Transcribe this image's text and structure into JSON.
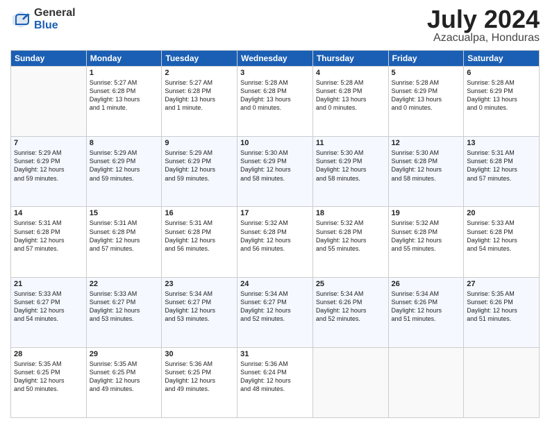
{
  "header": {
    "logo_general": "General",
    "logo_blue": "Blue",
    "month_year": "July 2024",
    "location": "Azacualpa, Honduras"
  },
  "days_of_week": [
    "Sunday",
    "Monday",
    "Tuesday",
    "Wednesday",
    "Thursday",
    "Friday",
    "Saturday"
  ],
  "weeks": [
    [
      {
        "day": "",
        "content": ""
      },
      {
        "day": "1",
        "content": "Sunrise: 5:27 AM\nSunset: 6:28 PM\nDaylight: 13 hours\nand 1 minute."
      },
      {
        "day": "2",
        "content": "Sunrise: 5:27 AM\nSunset: 6:28 PM\nDaylight: 13 hours\nand 1 minute."
      },
      {
        "day": "3",
        "content": "Sunrise: 5:28 AM\nSunset: 6:28 PM\nDaylight: 13 hours\nand 0 minutes."
      },
      {
        "day": "4",
        "content": "Sunrise: 5:28 AM\nSunset: 6:28 PM\nDaylight: 13 hours\nand 0 minutes."
      },
      {
        "day": "5",
        "content": "Sunrise: 5:28 AM\nSunset: 6:29 PM\nDaylight: 13 hours\nand 0 minutes."
      },
      {
        "day": "6",
        "content": "Sunrise: 5:28 AM\nSunset: 6:29 PM\nDaylight: 13 hours\nand 0 minutes."
      }
    ],
    [
      {
        "day": "7",
        "content": "Sunrise: 5:29 AM\nSunset: 6:29 PM\nDaylight: 12 hours\nand 59 minutes."
      },
      {
        "day": "8",
        "content": "Sunrise: 5:29 AM\nSunset: 6:29 PM\nDaylight: 12 hours\nand 59 minutes."
      },
      {
        "day": "9",
        "content": "Sunrise: 5:29 AM\nSunset: 6:29 PM\nDaylight: 12 hours\nand 59 minutes."
      },
      {
        "day": "10",
        "content": "Sunrise: 5:30 AM\nSunset: 6:29 PM\nDaylight: 12 hours\nand 58 minutes."
      },
      {
        "day": "11",
        "content": "Sunrise: 5:30 AM\nSunset: 6:29 PM\nDaylight: 12 hours\nand 58 minutes."
      },
      {
        "day": "12",
        "content": "Sunrise: 5:30 AM\nSunset: 6:28 PM\nDaylight: 12 hours\nand 58 minutes."
      },
      {
        "day": "13",
        "content": "Sunrise: 5:31 AM\nSunset: 6:28 PM\nDaylight: 12 hours\nand 57 minutes."
      }
    ],
    [
      {
        "day": "14",
        "content": "Sunrise: 5:31 AM\nSunset: 6:28 PM\nDaylight: 12 hours\nand 57 minutes."
      },
      {
        "day": "15",
        "content": "Sunrise: 5:31 AM\nSunset: 6:28 PM\nDaylight: 12 hours\nand 57 minutes."
      },
      {
        "day": "16",
        "content": "Sunrise: 5:31 AM\nSunset: 6:28 PM\nDaylight: 12 hours\nand 56 minutes."
      },
      {
        "day": "17",
        "content": "Sunrise: 5:32 AM\nSunset: 6:28 PM\nDaylight: 12 hours\nand 56 minutes."
      },
      {
        "day": "18",
        "content": "Sunrise: 5:32 AM\nSunset: 6:28 PM\nDaylight: 12 hours\nand 55 minutes."
      },
      {
        "day": "19",
        "content": "Sunrise: 5:32 AM\nSunset: 6:28 PM\nDaylight: 12 hours\nand 55 minutes."
      },
      {
        "day": "20",
        "content": "Sunrise: 5:33 AM\nSunset: 6:28 PM\nDaylight: 12 hours\nand 54 minutes."
      }
    ],
    [
      {
        "day": "21",
        "content": "Sunrise: 5:33 AM\nSunset: 6:27 PM\nDaylight: 12 hours\nand 54 minutes."
      },
      {
        "day": "22",
        "content": "Sunrise: 5:33 AM\nSunset: 6:27 PM\nDaylight: 12 hours\nand 53 minutes."
      },
      {
        "day": "23",
        "content": "Sunrise: 5:34 AM\nSunset: 6:27 PM\nDaylight: 12 hours\nand 53 minutes."
      },
      {
        "day": "24",
        "content": "Sunrise: 5:34 AM\nSunset: 6:27 PM\nDaylight: 12 hours\nand 52 minutes."
      },
      {
        "day": "25",
        "content": "Sunrise: 5:34 AM\nSunset: 6:26 PM\nDaylight: 12 hours\nand 52 minutes."
      },
      {
        "day": "26",
        "content": "Sunrise: 5:34 AM\nSunset: 6:26 PM\nDaylight: 12 hours\nand 51 minutes."
      },
      {
        "day": "27",
        "content": "Sunrise: 5:35 AM\nSunset: 6:26 PM\nDaylight: 12 hours\nand 51 minutes."
      }
    ],
    [
      {
        "day": "28",
        "content": "Sunrise: 5:35 AM\nSunset: 6:25 PM\nDaylight: 12 hours\nand 50 minutes."
      },
      {
        "day": "29",
        "content": "Sunrise: 5:35 AM\nSunset: 6:25 PM\nDaylight: 12 hours\nand 49 minutes."
      },
      {
        "day": "30",
        "content": "Sunrise: 5:36 AM\nSunset: 6:25 PM\nDaylight: 12 hours\nand 49 minutes."
      },
      {
        "day": "31",
        "content": "Sunrise: 5:36 AM\nSunset: 6:24 PM\nDaylight: 12 hours\nand 48 minutes."
      },
      {
        "day": "",
        "content": ""
      },
      {
        "day": "",
        "content": ""
      },
      {
        "day": "",
        "content": ""
      }
    ]
  ]
}
